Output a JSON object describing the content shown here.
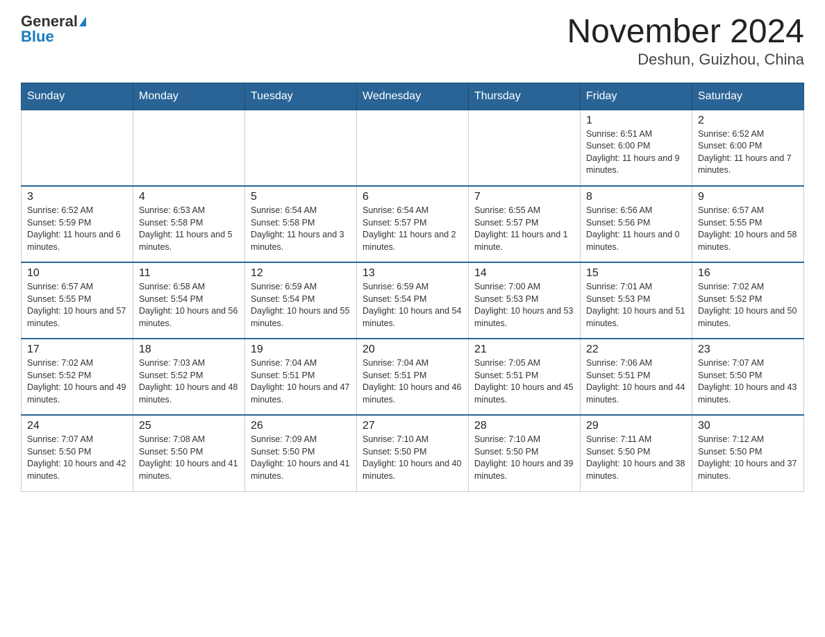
{
  "header": {
    "logo_general": "General",
    "logo_blue": "Blue",
    "month_title": "November 2024",
    "location": "Deshun, Guizhou, China"
  },
  "days_of_week": [
    "Sunday",
    "Monday",
    "Tuesday",
    "Wednesday",
    "Thursday",
    "Friday",
    "Saturday"
  ],
  "weeks": [
    [
      {
        "day": "",
        "info": ""
      },
      {
        "day": "",
        "info": ""
      },
      {
        "day": "",
        "info": ""
      },
      {
        "day": "",
        "info": ""
      },
      {
        "day": "",
        "info": ""
      },
      {
        "day": "1",
        "info": "Sunrise: 6:51 AM\nSunset: 6:00 PM\nDaylight: 11 hours and 9 minutes."
      },
      {
        "day": "2",
        "info": "Sunrise: 6:52 AM\nSunset: 6:00 PM\nDaylight: 11 hours and 7 minutes."
      }
    ],
    [
      {
        "day": "3",
        "info": "Sunrise: 6:52 AM\nSunset: 5:59 PM\nDaylight: 11 hours and 6 minutes."
      },
      {
        "day": "4",
        "info": "Sunrise: 6:53 AM\nSunset: 5:58 PM\nDaylight: 11 hours and 5 minutes."
      },
      {
        "day": "5",
        "info": "Sunrise: 6:54 AM\nSunset: 5:58 PM\nDaylight: 11 hours and 3 minutes."
      },
      {
        "day": "6",
        "info": "Sunrise: 6:54 AM\nSunset: 5:57 PM\nDaylight: 11 hours and 2 minutes."
      },
      {
        "day": "7",
        "info": "Sunrise: 6:55 AM\nSunset: 5:57 PM\nDaylight: 11 hours and 1 minute."
      },
      {
        "day": "8",
        "info": "Sunrise: 6:56 AM\nSunset: 5:56 PM\nDaylight: 11 hours and 0 minutes."
      },
      {
        "day": "9",
        "info": "Sunrise: 6:57 AM\nSunset: 5:55 PM\nDaylight: 10 hours and 58 minutes."
      }
    ],
    [
      {
        "day": "10",
        "info": "Sunrise: 6:57 AM\nSunset: 5:55 PM\nDaylight: 10 hours and 57 minutes."
      },
      {
        "day": "11",
        "info": "Sunrise: 6:58 AM\nSunset: 5:54 PM\nDaylight: 10 hours and 56 minutes."
      },
      {
        "day": "12",
        "info": "Sunrise: 6:59 AM\nSunset: 5:54 PM\nDaylight: 10 hours and 55 minutes."
      },
      {
        "day": "13",
        "info": "Sunrise: 6:59 AM\nSunset: 5:54 PM\nDaylight: 10 hours and 54 minutes."
      },
      {
        "day": "14",
        "info": "Sunrise: 7:00 AM\nSunset: 5:53 PM\nDaylight: 10 hours and 53 minutes."
      },
      {
        "day": "15",
        "info": "Sunrise: 7:01 AM\nSunset: 5:53 PM\nDaylight: 10 hours and 51 minutes."
      },
      {
        "day": "16",
        "info": "Sunrise: 7:02 AM\nSunset: 5:52 PM\nDaylight: 10 hours and 50 minutes."
      }
    ],
    [
      {
        "day": "17",
        "info": "Sunrise: 7:02 AM\nSunset: 5:52 PM\nDaylight: 10 hours and 49 minutes."
      },
      {
        "day": "18",
        "info": "Sunrise: 7:03 AM\nSunset: 5:52 PM\nDaylight: 10 hours and 48 minutes."
      },
      {
        "day": "19",
        "info": "Sunrise: 7:04 AM\nSunset: 5:51 PM\nDaylight: 10 hours and 47 minutes."
      },
      {
        "day": "20",
        "info": "Sunrise: 7:04 AM\nSunset: 5:51 PM\nDaylight: 10 hours and 46 minutes."
      },
      {
        "day": "21",
        "info": "Sunrise: 7:05 AM\nSunset: 5:51 PM\nDaylight: 10 hours and 45 minutes."
      },
      {
        "day": "22",
        "info": "Sunrise: 7:06 AM\nSunset: 5:51 PM\nDaylight: 10 hours and 44 minutes."
      },
      {
        "day": "23",
        "info": "Sunrise: 7:07 AM\nSunset: 5:50 PM\nDaylight: 10 hours and 43 minutes."
      }
    ],
    [
      {
        "day": "24",
        "info": "Sunrise: 7:07 AM\nSunset: 5:50 PM\nDaylight: 10 hours and 42 minutes."
      },
      {
        "day": "25",
        "info": "Sunrise: 7:08 AM\nSunset: 5:50 PM\nDaylight: 10 hours and 41 minutes."
      },
      {
        "day": "26",
        "info": "Sunrise: 7:09 AM\nSunset: 5:50 PM\nDaylight: 10 hours and 41 minutes."
      },
      {
        "day": "27",
        "info": "Sunrise: 7:10 AM\nSunset: 5:50 PM\nDaylight: 10 hours and 40 minutes."
      },
      {
        "day": "28",
        "info": "Sunrise: 7:10 AM\nSunset: 5:50 PM\nDaylight: 10 hours and 39 minutes."
      },
      {
        "day": "29",
        "info": "Sunrise: 7:11 AM\nSunset: 5:50 PM\nDaylight: 10 hours and 38 minutes."
      },
      {
        "day": "30",
        "info": "Sunrise: 7:12 AM\nSunset: 5:50 PM\nDaylight: 10 hours and 37 minutes."
      }
    ]
  ]
}
